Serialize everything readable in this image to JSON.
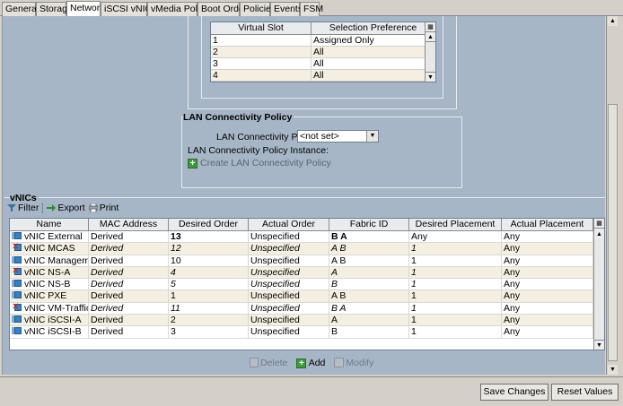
{
  "tabs": [
    {
      "label": "General"
    },
    {
      "label": "Storage"
    },
    {
      "label": "Network",
      "active": true
    },
    {
      "label": "iSCSI vNICs"
    },
    {
      "label": "vMedia Policy"
    },
    {
      "label": "Boot Order"
    },
    {
      "label": "Policies"
    },
    {
      "label": "Events"
    },
    {
      "label": "FSM"
    }
  ],
  "slot_table": {
    "headers": [
      "Virtual Slot",
      "Selection Preference"
    ],
    "rows": [
      [
        "1",
        "Assigned Only"
      ],
      [
        "2",
        "All"
      ],
      [
        "3",
        "All"
      ],
      [
        "4",
        "All"
      ]
    ]
  },
  "lan": {
    "title": "LAN Connectivity Policy",
    "policy_label": "LAN Connectivity Policy:",
    "policy_value": "<not set>",
    "instance_label": "LAN Connectivity Policy Instance:",
    "create_label": "Create LAN Connectivity Policy"
  },
  "vnics": {
    "title": "vNICs",
    "toolbar": {
      "filter": "Filter",
      "export": "Export",
      "print": "Print"
    },
    "headers": [
      "Name",
      "MAC Address",
      "Desired Order",
      "Actual Order",
      "Fabric ID",
      "Desired Placement",
      "Actual Placement"
    ],
    "rows": [
      {
        "name": "vNIC External",
        "mac": "Derived",
        "desired_order": "13",
        "actual_order": "Unspecified",
        "fabric": "B A",
        "desired_placement": "Any",
        "actual_placement": "Any",
        "status": "ok",
        "italic": false
      },
      {
        "name": "vNIC MCAS",
        "mac": "Derived",
        "desired_order": "12",
        "actual_order": "Unspecified",
        "fabric": "A B",
        "desired_placement": "1",
        "actual_placement": "Any",
        "status": "error",
        "italic": true
      },
      {
        "name": "vNIC Management",
        "mac": "Derived",
        "desired_order": "10",
        "actual_order": "Unspecified",
        "fabric": "A B",
        "desired_placement": "1",
        "actual_placement": "Any",
        "status": "ok",
        "italic": false
      },
      {
        "name": "vNIC NS-A",
        "mac": "Derived",
        "desired_order": "4",
        "actual_order": "Unspecified",
        "fabric": "A",
        "desired_placement": "1",
        "actual_placement": "Any",
        "status": "error",
        "italic": true
      },
      {
        "name": "vNIC NS-B",
        "mac": "Derived",
        "desired_order": "5",
        "actual_order": "Unspecified",
        "fabric": "B",
        "desired_placement": "1",
        "actual_placement": "Any",
        "status": "ok",
        "italic": true
      },
      {
        "name": "vNIC PXE",
        "mac": "Derived",
        "desired_order": "1",
        "actual_order": "Unspecified",
        "fabric": "A B",
        "desired_placement": "1",
        "actual_placement": "Any",
        "status": "ok",
        "italic": false
      },
      {
        "name": "vNIC VM-Traffic",
        "mac": "Derived",
        "desired_order": "11",
        "actual_order": "Unspecified",
        "fabric": "B A",
        "desired_placement": "1",
        "actual_placement": "Any",
        "status": "error",
        "italic": true
      },
      {
        "name": "vNIC iSCSI-A",
        "mac": "Derived",
        "desired_order": "2",
        "actual_order": "Unspecified",
        "fabric": "A",
        "desired_placement": "1",
        "actual_placement": "Any",
        "status": "ok",
        "italic": false
      },
      {
        "name": "vNIC iSCSI-B",
        "mac": "Derived",
        "desired_order": "3",
        "actual_order": "Unspecified",
        "fabric": "B",
        "desired_placement": "1",
        "actual_placement": "Any",
        "status": "ok",
        "italic": false
      }
    ],
    "actions": {
      "delete": "Delete",
      "add": "Add",
      "modify": "Modify"
    }
  },
  "buttons": {
    "save": "Save Changes",
    "reset": "Reset Values"
  },
  "colors": {
    "panel_bg": "#a7b6c6",
    "row_alt": "#f4efe1",
    "add_green": "#3c9a3c",
    "error_red": "#d01c1c"
  }
}
